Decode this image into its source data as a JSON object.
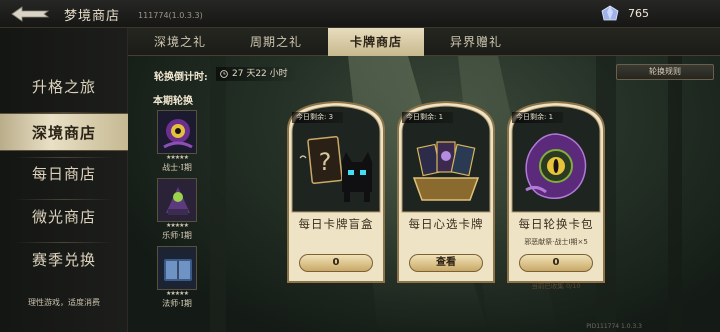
{
  "header": {
    "title": "梦境商店",
    "version": "111774(1.0.3.3)",
    "currency_icon": "crystal-gem-icon",
    "currency_amount": "765"
  },
  "sidebar": {
    "items": [
      {
        "label": "升格之旅",
        "active": false
      },
      {
        "label": "深境商店",
        "active": true
      },
      {
        "label": "每日商店",
        "active": false
      },
      {
        "label": "微光商店",
        "active": false
      },
      {
        "label": "赛季兑换",
        "active": false
      }
    ],
    "footer": "理性游戏，适度消费"
  },
  "tabs": [
    {
      "label": "深境之礼",
      "active": false
    },
    {
      "label": "周期之礼",
      "active": false
    },
    {
      "label": "卡牌商店",
      "active": true
    },
    {
      "label": "异界赠礼",
      "active": false
    }
  ],
  "countdown": {
    "label": "轮换倒计时:",
    "value": "27 天22 小时"
  },
  "rules_button": "轮换规则",
  "rotation": {
    "title": "本期轮换",
    "items": [
      {
        "name": "战士·I期",
        "stars": "★★★★★",
        "icon": "eldritch-eye-card-icon"
      },
      {
        "name": "乐师·I期",
        "stars": "★★★★★",
        "icon": "bard-card-icon"
      },
      {
        "name": "法师·I期",
        "stars": "★★★★★",
        "icon": "mage-tome-card-icon"
      }
    ]
  },
  "cards": [
    {
      "remaining": "今日剩余: 3",
      "name": "每日卡牌盲盒",
      "button": "0",
      "art": "mystery-card-cat-icon",
      "sub": "",
      "collected": ""
    },
    {
      "remaining": "今日剩余: 1",
      "name": "每日心选卡牌",
      "button": "查看",
      "art": "treasure-cards-icon",
      "sub": "",
      "collected": ""
    },
    {
      "remaining": "今日剩余: 1",
      "name": "每日轮换卡包",
      "button": "0",
      "art": "eldritch-eye-pack-icon",
      "sub": "邪恶献祭·战士I期×5",
      "collected": "当前已收集 0/10"
    }
  ],
  "watermark": "PID111774 1.0.3.3",
  "colors": {
    "accent_gold": "#e7dcbd",
    "card_parchment": "#efe3c6",
    "button_gold": "#c9a967"
  }
}
